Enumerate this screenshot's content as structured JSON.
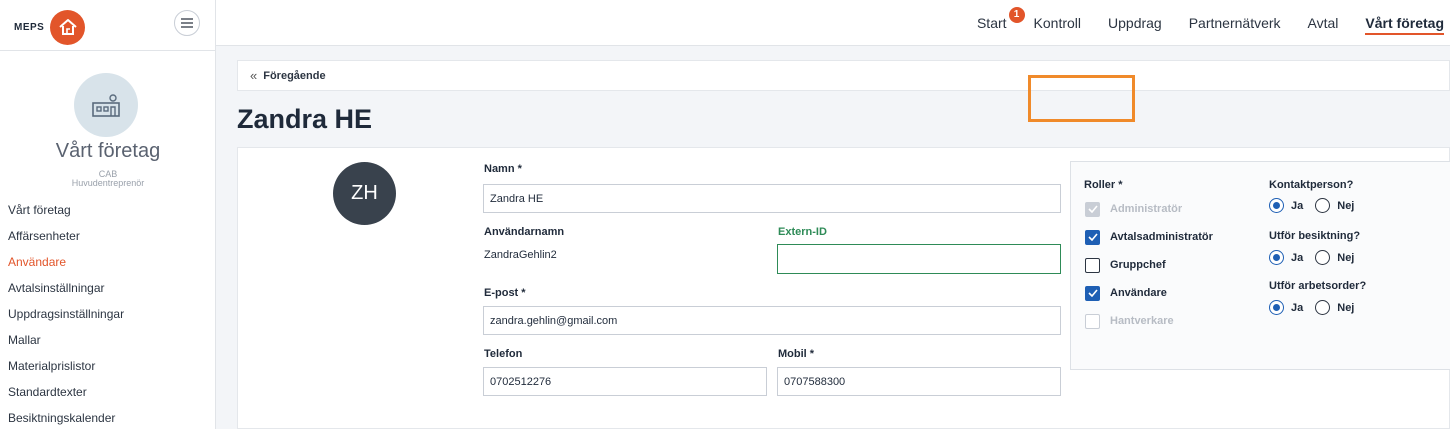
{
  "brand": {
    "logo_text": "MEPS"
  },
  "sidebar": {
    "company_name": "Vårt företag",
    "company_short": "CAB",
    "company_role": "Huvudentreprenör",
    "items": [
      {
        "label": "Vårt företag"
      },
      {
        "label": "Affärsenheter"
      },
      {
        "label": "Användare"
      },
      {
        "label": "Avtalsinställningar"
      },
      {
        "label": "Uppdragsinställningar"
      },
      {
        "label": "Mallar"
      },
      {
        "label": "Materialprislistor"
      },
      {
        "label": "Standardtexter"
      },
      {
        "label": "Besiktningskalender"
      }
    ],
    "active_item": "Användare"
  },
  "topnav": {
    "items": [
      {
        "label": "Start"
      },
      {
        "label": "Kontroll"
      },
      {
        "label": "Uppdrag"
      },
      {
        "label": "Partnernätverk"
      },
      {
        "label": "Avtal"
      },
      {
        "label": "Vårt företag"
      }
    ],
    "start_badge": "1",
    "active_item": "Vårt företag"
  },
  "breadcrumb": {
    "back_label": "Föregående"
  },
  "page": {
    "title": "Zandra HE"
  },
  "user": {
    "initials": "ZH",
    "name_label": "Namn *",
    "name_value": "Zandra HE",
    "username_label": "Användarnamn",
    "username_value": "ZandraGehlin2",
    "extern_id_label": "Extern-ID",
    "extern_id_value": "",
    "email_label": "E-post *",
    "email_value": "zandra.gehlin@gmail.com",
    "phone_label": "Telefon",
    "phone_value": "0702512276",
    "mobile_label": "Mobil *",
    "mobile_value": "0707588300"
  },
  "roles": {
    "label": "Roller *",
    "items": [
      {
        "label": "Administratör",
        "checked": true,
        "disabled": true
      },
      {
        "label": "Avtalsadministratör",
        "checked": true,
        "disabled": false
      },
      {
        "label": "Gruppchef",
        "checked": false,
        "disabled": false
      },
      {
        "label": "Användare",
        "checked": true,
        "disabled": false
      },
      {
        "label": "Hantverkare",
        "checked": false,
        "disabled": true
      }
    ]
  },
  "questions": {
    "contact_label": "Kontaktperson?",
    "inspection_label": "Utför besiktning?",
    "workorder_label": "Utför arbetsorder?",
    "yes": "Ja",
    "no": "Nej",
    "contact_value": "Ja",
    "inspection_value": "Ja",
    "workorder_value": "Ja"
  },
  "colors": {
    "accent": "#e2552a",
    "primary": "#1e5fb4",
    "highlight": "#f08a2a",
    "green": "#2e8b57"
  }
}
